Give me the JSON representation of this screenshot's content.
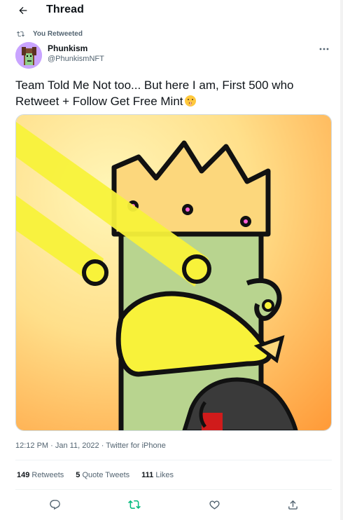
{
  "header": {
    "title": "Thread"
  },
  "retweet_context": {
    "label": "You Retweeted"
  },
  "author": {
    "name": "Phunkism",
    "handle": "@PhunkismNFT"
  },
  "tweet": {
    "text": "Team Told Me Not too... But here I am, First 500 who Retweet + Follow Get Free Mint",
    "emoji": "shushing-face"
  },
  "meta": {
    "time": "12:12 PM",
    "sep1": " · ",
    "date": "Jan 11, 2022",
    "sep2": " · ",
    "source": "Twitter for iPhone"
  },
  "stats": {
    "retweets_count": "149",
    "retweets_label": "Retweets",
    "quotes_count": "5",
    "quotes_label": "Quote Tweets",
    "likes_count": "111",
    "likes_label": "Likes"
  },
  "colors": {
    "text": "#0f1419",
    "secondary": "#536471",
    "retweet_green": "#00ba7c",
    "divider": "#eff3f4"
  },
  "icons": [
    "back-arrow-icon",
    "retweet-icon",
    "more-icon",
    "reply-icon",
    "retweet-icon",
    "like-icon",
    "share-icon"
  ]
}
